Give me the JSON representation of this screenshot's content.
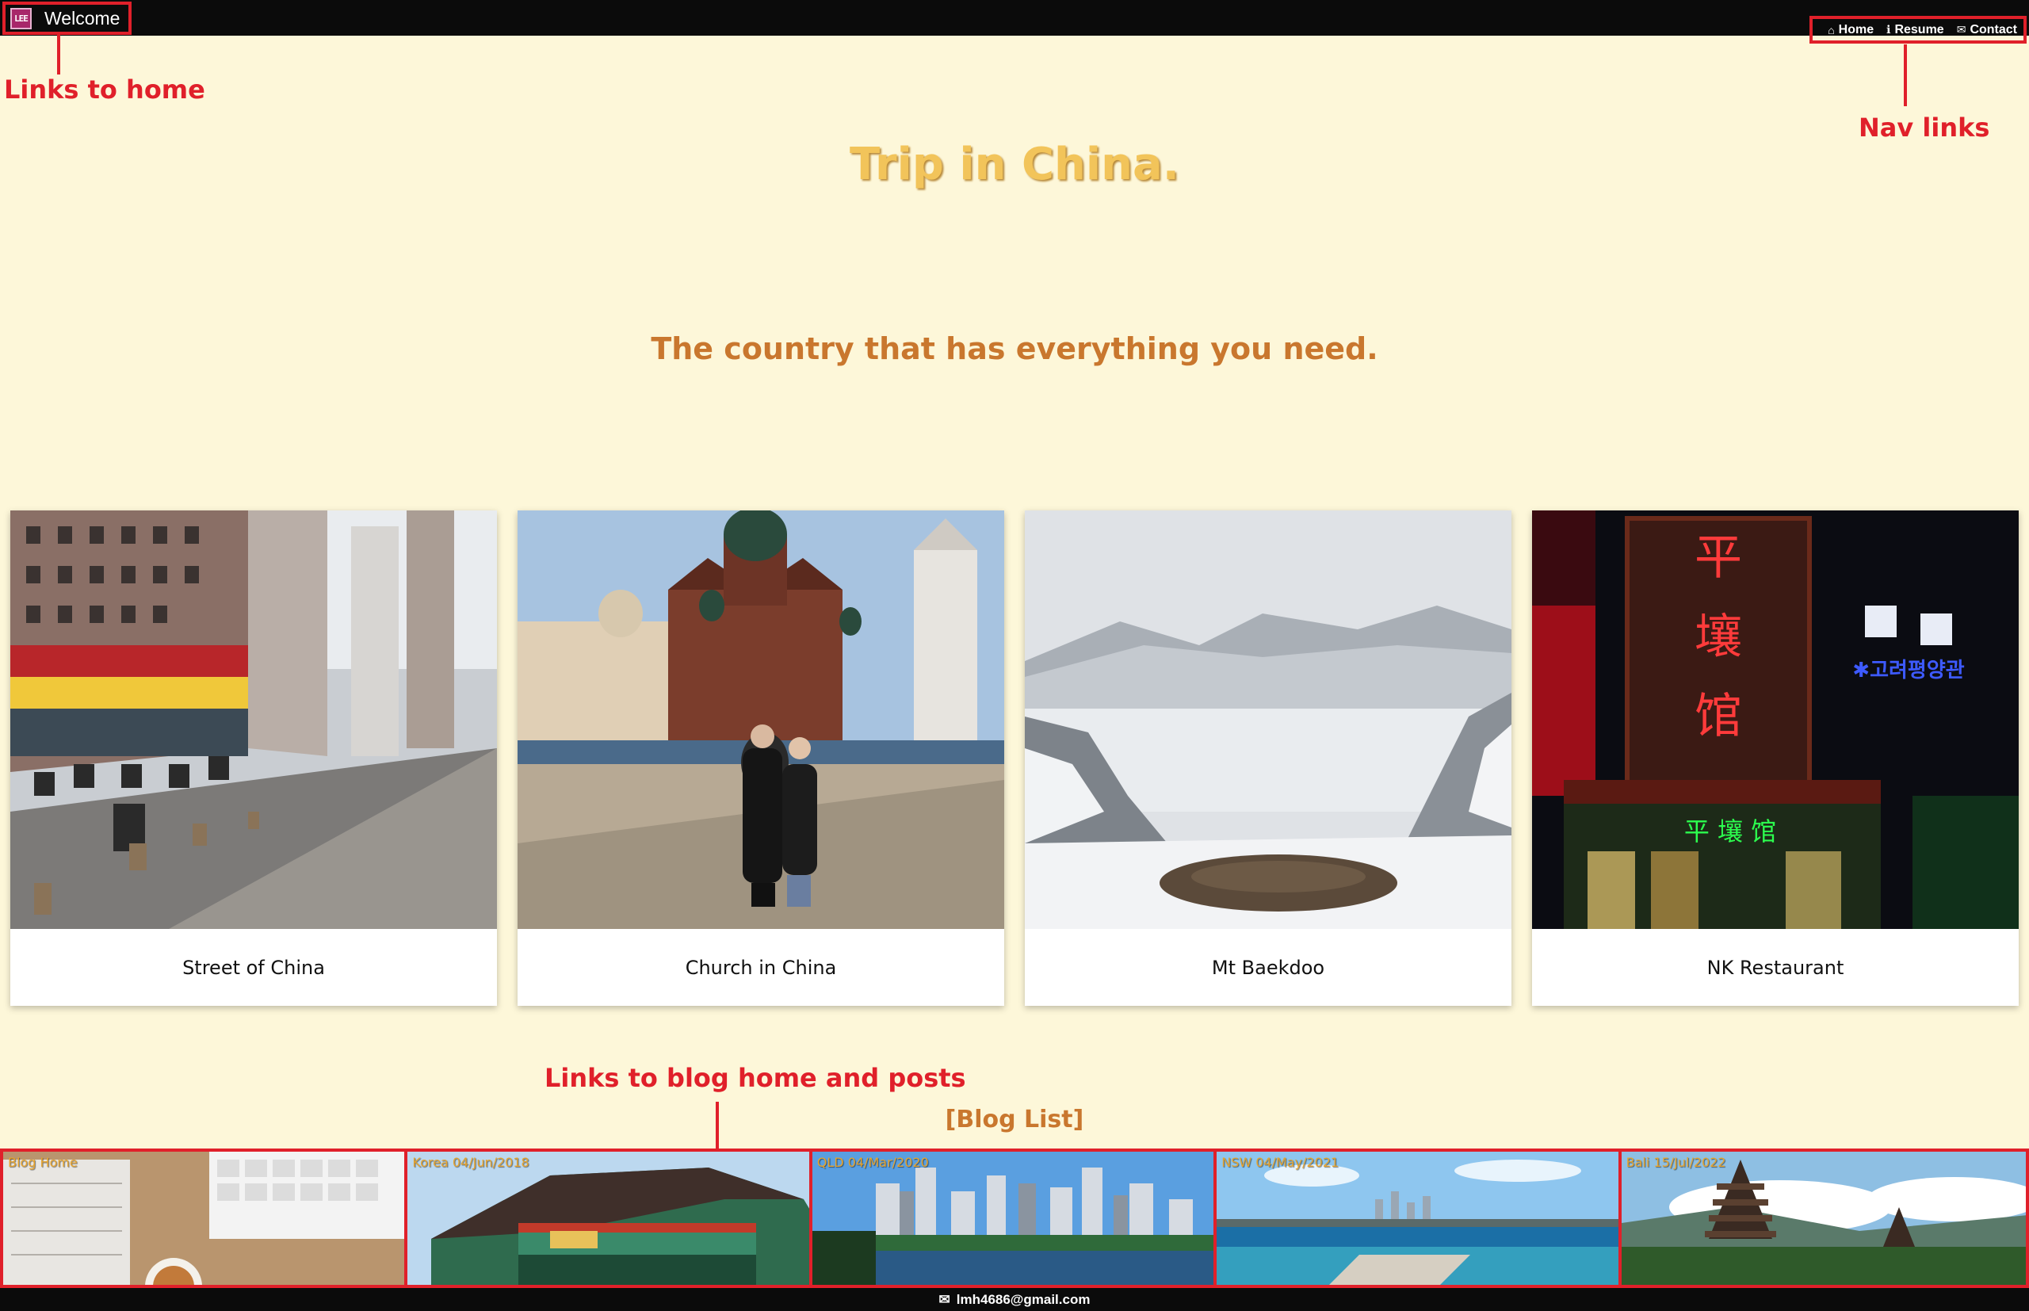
{
  "header": {
    "brand_logo": "LEE",
    "brand_text": "Welcome",
    "nav": [
      {
        "icon": "home-icon",
        "glyph": "⌂",
        "label": "Home"
      },
      {
        "icon": "info-icon",
        "glyph": "ℹ",
        "label": "Resume"
      },
      {
        "icon": "mail-icon",
        "glyph": "✉",
        "label": "Contact"
      }
    ]
  },
  "annotations": {
    "home": "Links to home",
    "nav": "Nav links",
    "blog": "Links to blog home and posts"
  },
  "hero": {
    "title": "Trip in China.",
    "subtitle": "The country that has everything you need."
  },
  "cards": [
    {
      "caption": "Street of China"
    },
    {
      "caption": "Church in China"
    },
    {
      "caption": "Mt Baekdoo"
    },
    {
      "caption": "NK Restaurant"
    }
  ],
  "blog": {
    "label": "[Blog List]",
    "items": [
      {
        "tag": "Blog Home"
      },
      {
        "tag": "Korea 04/Jun/2018"
      },
      {
        "tag": "QLD 04/Mar/2020"
      },
      {
        "tag": "NSW 04/May/2021"
      },
      {
        "tag": "Bali 15/Jul/2022"
      }
    ]
  },
  "footer": {
    "icon": "mail-icon",
    "email": "lmh4686@gmail.com"
  },
  "colors": {
    "background": "#fdf7d9",
    "accent_red": "#e0202a",
    "title_gold": "#f2c45a",
    "subtitle_orange": "#c9772e",
    "bar": "#0b0b0b"
  }
}
